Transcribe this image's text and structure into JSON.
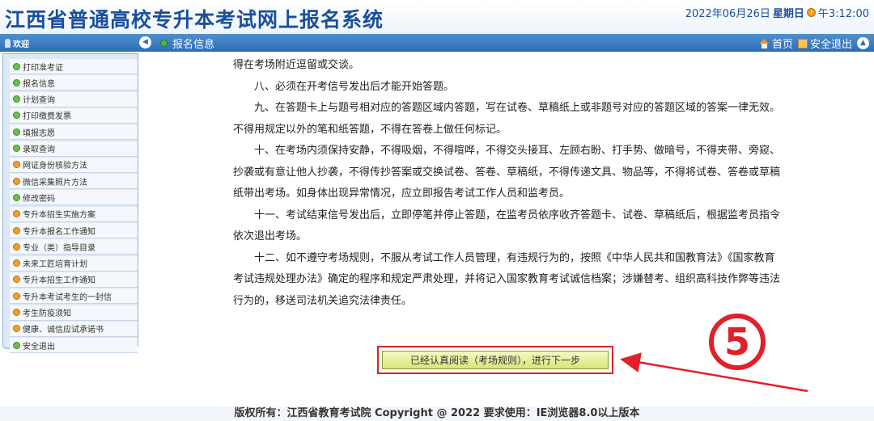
{
  "header": {
    "title": "江西省普通高校专升本考试网上报名系统",
    "date": "2022年06月26日",
    "weekday": "星期日",
    "time": "午3:12:00"
  },
  "bar": {
    "welcome": "欢迎",
    "collapse": "◀",
    "breadcrumb": "报名信息",
    "home": "首页",
    "logout": "安全退出",
    "up": "▲"
  },
  "sidebar": {
    "items": [
      {
        "label": "打印准考证",
        "color": "green"
      },
      {
        "label": "报名信息",
        "color": "green"
      },
      {
        "label": "计划查询",
        "color": "green"
      },
      {
        "label": "打印缴费发票",
        "color": "green"
      },
      {
        "label": "填报志愿",
        "color": "green"
      },
      {
        "label": "录取查询",
        "color": "green"
      },
      {
        "label": "网证身份核验方法",
        "color": "orange"
      },
      {
        "label": "微信采集照片方法",
        "color": "orange"
      },
      {
        "label": "修改密码",
        "color": "green"
      },
      {
        "label": "专升本招生实施方案",
        "color": "orange"
      },
      {
        "label": "专升本报名工作通知",
        "color": "orange"
      },
      {
        "label": "专业（类）指导目录",
        "color": "orange"
      },
      {
        "label": "未来工匠培育计划",
        "color": "orange"
      },
      {
        "label": "专升本招生工作通知",
        "color": "orange"
      },
      {
        "label": "专升本考试考生的一封信",
        "color": "orange"
      },
      {
        "label": "考生防疫须知",
        "color": "orange"
      },
      {
        "label": "健康、诚信应试承诺书",
        "color": "orange"
      },
      {
        "label": "安全退出",
        "color": "green"
      }
    ]
  },
  "content": {
    "paragraphs": [
      {
        "text": "得在考场附近逗留或交谈。",
        "indent": false
      },
      {
        "text": "八、必须在开考信号发出后才能开始答题。",
        "indent": true
      },
      {
        "text": "九、在答题卡上与题号相对应的答题区域内答题，写在试卷、草稿纸上或非题号对应的答题区域的答案一律无效。不得用规定以外的笔和纸答题，不得在答卷上做任何标记。",
        "indent": true
      },
      {
        "text": "十、在考场内须保持安静，不得吸烟，不得喧哗，不得交头接耳、左顾右盼、打手势、做暗号，不得夹带、旁窥、抄袭或有意让他人抄袭，不得传抄答案或交换试卷、答卷、草稿纸，不得传递文具、物品等，不得将试卷、答卷或草稿纸带出考场。如身体出现异常情况，应立即报告考试工作人员和监考员。",
        "indent": true
      },
      {
        "text": "十一、考试结束信号发出后，立即停笔并停止答题，在监考员依序收齐答题卡、试卷、草稿纸后，根据监考员指令依次退出考场。",
        "indent": true
      },
      {
        "text": "十二、如不遵守考场规则，不服从考试工作人员管理，有违规行为的，按照《中华人民共和国教育法》《国家教育考试违规处理办法》确定的程序和规定严肃处理，并将记入国家教育考试诚信档案；涉嫌替考、组织高科技作弊等违法行为的，移送司法机关追究法律责任。",
        "indent": true
      }
    ],
    "confirm_button": "已经认真阅读（考场规则），进行下一步"
  },
  "annotation": {
    "number": "5",
    "color": "#e0202a"
  },
  "footer": {
    "text": "版权所有：江西省教育考试院 Copyright @ 2022 要求使用：IE浏览器8.0以上版本"
  }
}
